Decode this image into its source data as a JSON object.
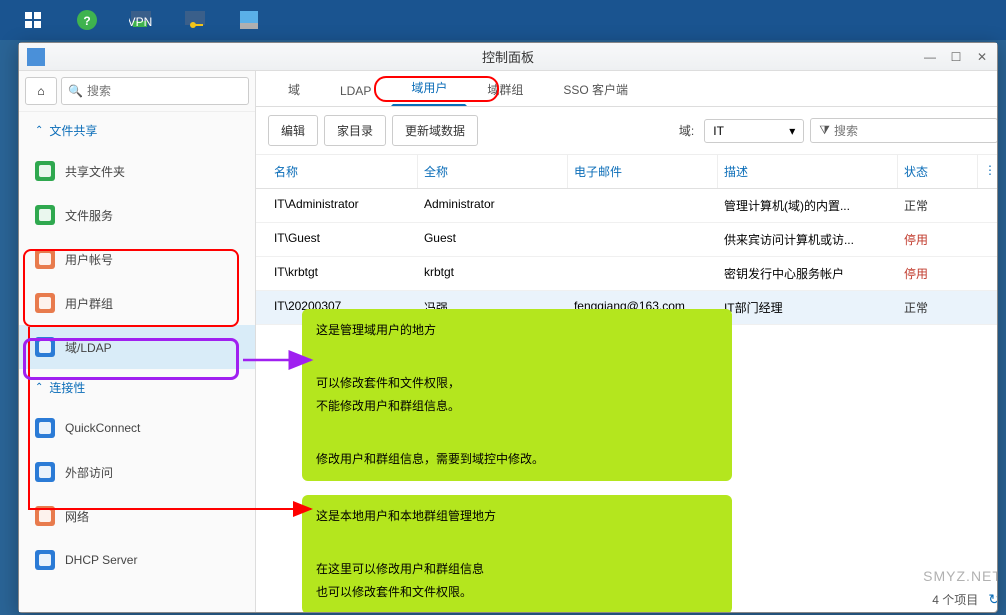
{
  "taskbar": {
    "items": [
      "apps",
      "help",
      "vpn",
      "key-manager",
      "package"
    ]
  },
  "window": {
    "title": "控制面板"
  },
  "sidebar": {
    "search_placeholder": "搜索",
    "sections": [
      {
        "label": "文件共享",
        "items": [
          {
            "label": "共享文件夹",
            "icon": "folder",
            "color": "#2fa84f"
          },
          {
            "label": "文件服务",
            "icon": "transfer",
            "color": "#2fa84f"
          },
          {
            "label": "用户帐号",
            "icon": "user",
            "color": "#e87b4d"
          },
          {
            "label": "用户群组",
            "icon": "users",
            "color": "#e87b4d"
          },
          {
            "label": "域/LDAP",
            "icon": "domain",
            "color": "#2b7bd6",
            "active": true
          }
        ]
      },
      {
        "label": "连接性",
        "items": [
          {
            "label": "QuickConnect",
            "icon": "cloud",
            "color": "#2b7bd6"
          },
          {
            "label": "外部访问",
            "icon": "globe",
            "color": "#2b7bd6"
          },
          {
            "label": "网络",
            "icon": "network",
            "color": "#e87b4d"
          },
          {
            "label": "DHCP Server",
            "icon": "dhcp",
            "color": "#2b7bd6"
          }
        ]
      }
    ]
  },
  "tabs": [
    "域",
    "LDAP",
    "域用户",
    "域群组",
    "SSO 客户端"
  ],
  "active_tab": 2,
  "toolbar": {
    "edit": "编辑",
    "home": "家目录",
    "update": "更新域数据",
    "domain_label": "域:",
    "domain_value": "IT",
    "search_placeholder": "搜索"
  },
  "columns": {
    "name": "名称",
    "full": "全称",
    "email": "电子邮件",
    "desc": "描述",
    "status": "状态"
  },
  "rows": [
    {
      "name": "IT\\Administrator",
      "full": "Administrator",
      "email": "",
      "desc": "管理计算机(域)的内置...",
      "status": "正常",
      "status_class": "normal"
    },
    {
      "name": "IT\\Guest",
      "full": "Guest",
      "email": "",
      "desc": "供来宾访问计算机或访...",
      "status": "停用",
      "status_class": "disabled"
    },
    {
      "name": "IT\\krbtgt",
      "full": "krbtgt",
      "email": "",
      "desc": "密钥发行中心服务帐户",
      "status": "停用",
      "status_class": "disabled"
    },
    {
      "name": "IT\\20200307",
      "full": "冯强",
      "email": "fengqiang@163.com",
      "desc": "IT部门经理",
      "status": "正常",
      "status_class": "normal",
      "selected": true
    }
  ],
  "footer": {
    "count": "4 个项目"
  },
  "annotations": {
    "a1_l1": "这是管理域用户的地方",
    "a1_l2": "可以修改套件和文件权限，",
    "a1_l3": "不能修改用户和群组信息。",
    "a1_l4": "修改用户和群组信息，需要到域控中修改。",
    "a2_l1": "这是本地用户和本地群组管理地方",
    "a2_l2": "在这里可以修改用户和群组信息",
    "a2_l3": "也可以修改套件和文件权限。"
  },
  "watermark": "SMYZ.NET"
}
